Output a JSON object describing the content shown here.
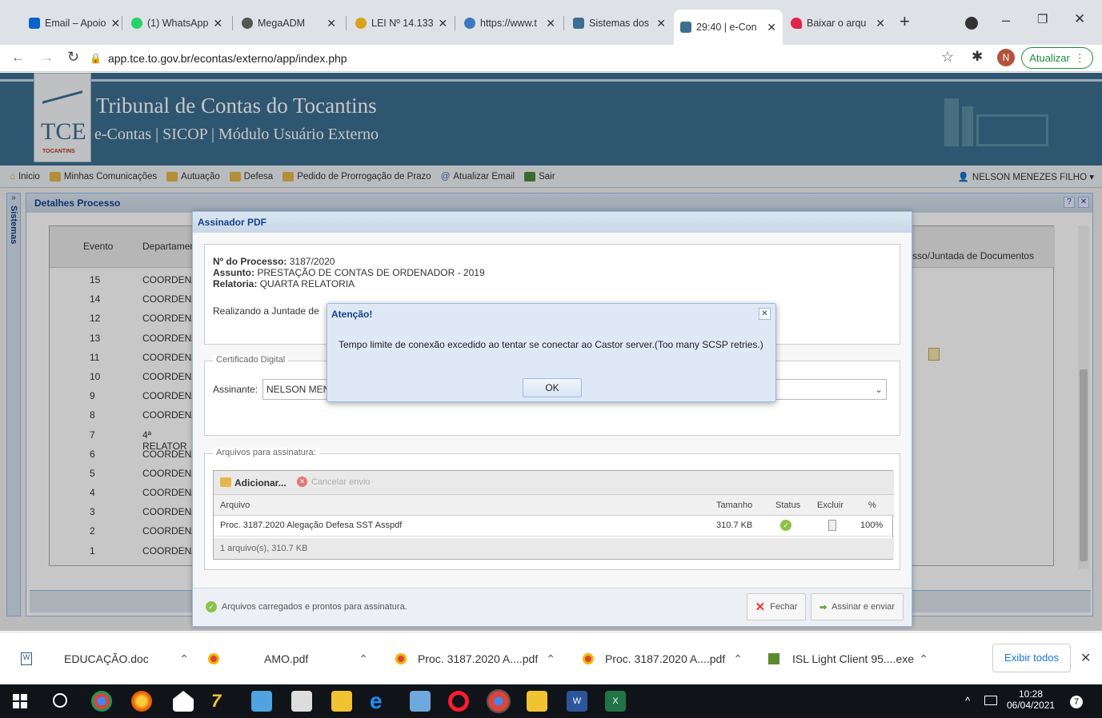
{
  "browser": {
    "tabs": [
      {
        "label": "Email – Apoio",
        "color": "#0a64c8"
      },
      {
        "label": "(1) WhatsApp",
        "color": "#25d366"
      },
      {
        "label": "MegaADM",
        "color": "#555555"
      },
      {
        "label": "LEI Nº 14.133",
        "color": "#d9a21b"
      },
      {
        "label": "https://www.t",
        "color": "#3a7bbf"
      },
      {
        "label": "Sistemas dos",
        "color": "#3d6f91"
      },
      {
        "label": "29:40 | e-Con",
        "color": "#3d6f91"
      },
      {
        "label": "Baixar o arqu",
        "color": "#e0244a"
      }
    ],
    "new_tab_icon": "plus-icon",
    "url": "app.tce.to.gov.br/econtas/externo/app/index.php",
    "update_label": "Atualizar",
    "avatar_letter": "N"
  },
  "banner": {
    "title": "Tribunal de Contas do Tocantins",
    "subtitle": "e-Contas | SICOP | Módulo Usuário Externo",
    "logo_text": "TCE",
    "logo_sub": "TOCANTINS"
  },
  "menu": {
    "items": [
      "Inicio",
      "Minhas Comunicações",
      "Autuação",
      "Defesa",
      "Pedido de Prorrogação de Prazo",
      "Atualizar Email",
      "Sair"
    ],
    "user": "NELSON MENEZES FILHO ▾"
  },
  "sidebar_label": "Sistemas",
  "detalhes": {
    "title": "Detalhes Processo",
    "columns": [
      "Evento",
      "Departament"
    ],
    "right_column": "sso/Juntada de Documentos",
    "rows": [
      {
        "evento": "15",
        "dep": "COORDENAC"
      },
      {
        "evento": "14",
        "dep": "COORDENAC"
      },
      {
        "evento": "12",
        "dep": "COORDENAC"
      },
      {
        "evento": "13",
        "dep": "COORDENAC"
      },
      {
        "evento": "11",
        "dep": "COORDENAC"
      },
      {
        "evento": "10",
        "dep": "COORDENAC"
      },
      {
        "evento": "9",
        "dep": "COORDENAC"
      },
      {
        "evento": "8",
        "dep": "COORDENAC"
      },
      {
        "evento": "7",
        "dep": "4ª RELATOR"
      },
      {
        "evento": "6",
        "dep": "COORDENAC"
      },
      {
        "evento": "5",
        "dep": "COORDENAC"
      },
      {
        "evento": "4",
        "dep": "COORDENAC"
      },
      {
        "evento": "3",
        "dep": "COORDENAC"
      },
      {
        "evento": "2",
        "dep": "COORDENAC"
      },
      {
        "evento": "1",
        "dep": "COORDENAC"
      }
    ]
  },
  "assinador": {
    "title": "Assinador PDF",
    "processo_label": "Nº do Processo:",
    "processo": "3187/2020",
    "assunto_label": "Assunto:",
    "assunto": "PRESTAÇÃO DE CONTAS DE ORDENADOR - 2019",
    "relatoria_label": "Relatoria:",
    "relatoria": "QUARTA RELATORIA",
    "status_line": "Realizando a Juntade de",
    "cert_legend": "Certificado Digital",
    "assinante_label": "Assinante:",
    "assinante_value": "NELSON MENI",
    "files_legend": "Arquivos para assinatura:",
    "add_label": "Adicionar...",
    "cancel_label": "Cancelar envio",
    "file_columns": [
      "Arquivo",
      "Tamanho",
      "Status",
      "Excluir",
      "%"
    ],
    "file": {
      "name": "Proc. 3187.2020 Alegação Defesa SST Asspdf",
      "size": "310.7 KB",
      "percent": "100%"
    },
    "files_summary": "1 arquivo(s), 310.7 KB",
    "footer_status": "Arquivos carregados e prontos para assinatura.",
    "close_label": "Fechar",
    "sign_label": "Assinar e enviar"
  },
  "alert": {
    "title": "Atenção!",
    "message": "Tempo limite de conexão excedido ao tentar se conectar ao Castor server.(Too many SCSP retries.)",
    "ok_label": "OK"
  },
  "downloads": {
    "items": [
      "EDUCAÇÃO.doc",
      "AMO.pdf",
      "Proc. 3187.2020 A....pdf",
      "Proc. 3187.2020 A....pdf",
      "ISL Light Client 95....exe"
    ],
    "show_all": "Exibir todos"
  },
  "taskbar": {
    "time": "10:28",
    "date": "06/04/2021",
    "notification_count": "7"
  }
}
